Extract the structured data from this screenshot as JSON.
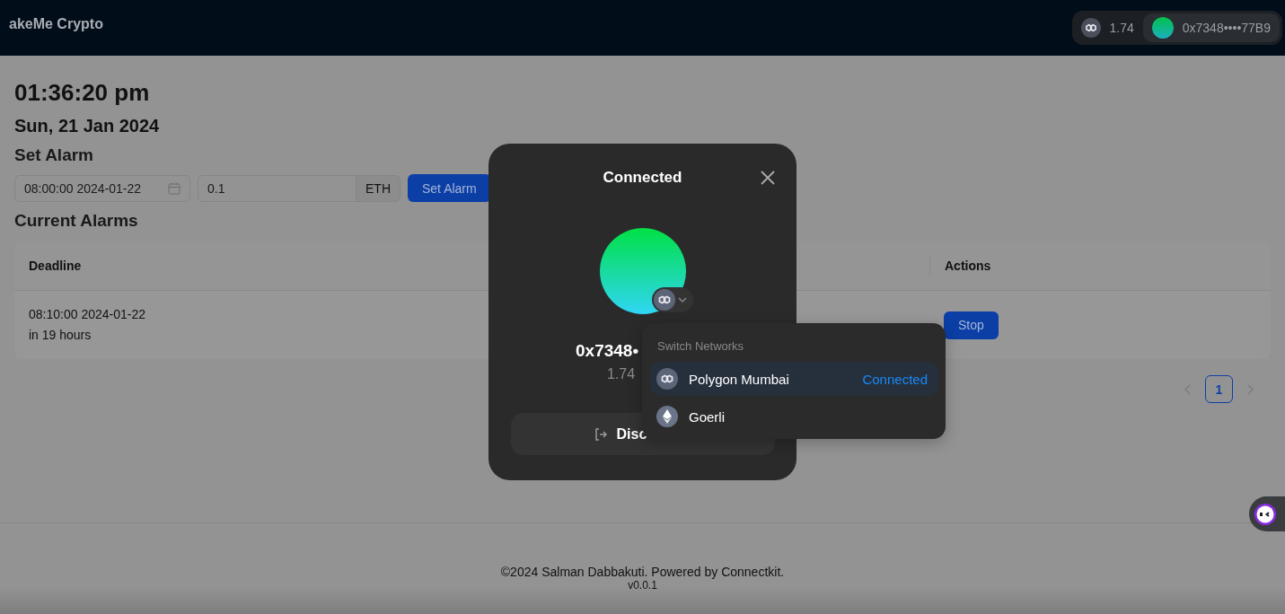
{
  "header": {
    "title": "akeMe Crypto",
    "balance": "1.74",
    "address": "0x7348••••77B9"
  },
  "clock": {
    "time": "01:36:20 pm",
    "date": "Sun, 21 Jan 2024"
  },
  "set_alarm": {
    "heading": "Set Alarm",
    "datetime_field": {
      "value": "08:00:00 2024-01-22"
    },
    "amount_field": {
      "value": "0.1",
      "unit": "ETH"
    },
    "button": "Set Alarm"
  },
  "alarms": {
    "heading": "Current Alarms",
    "columns": [
      "Deadline",
      "Actions"
    ],
    "rows": [
      {
        "deadline": "08:10:00 2024-01-22",
        "relative": "in 19 hours",
        "action": "Stop"
      }
    ]
  },
  "pagination": {
    "pages": [
      {
        "label": "1",
        "selected": true
      }
    ]
  },
  "footer": {
    "copyright": "©2024 Salman Dabbakuti. Powered by Connectkit.",
    "version": "v0.0.1"
  },
  "modal": {
    "title": "Connected",
    "address": "0x7348•",
    "balance": "1.74",
    "button": "Disc"
  },
  "network_menu": {
    "heading": "Switch Networks",
    "items": [
      {
        "name": "Polygon Mumbai",
        "kind": "polygon",
        "selected": true,
        "status": "Connected"
      },
      {
        "name": "Goerli",
        "kind": "ethereum",
        "selected": false
      }
    ]
  }
}
